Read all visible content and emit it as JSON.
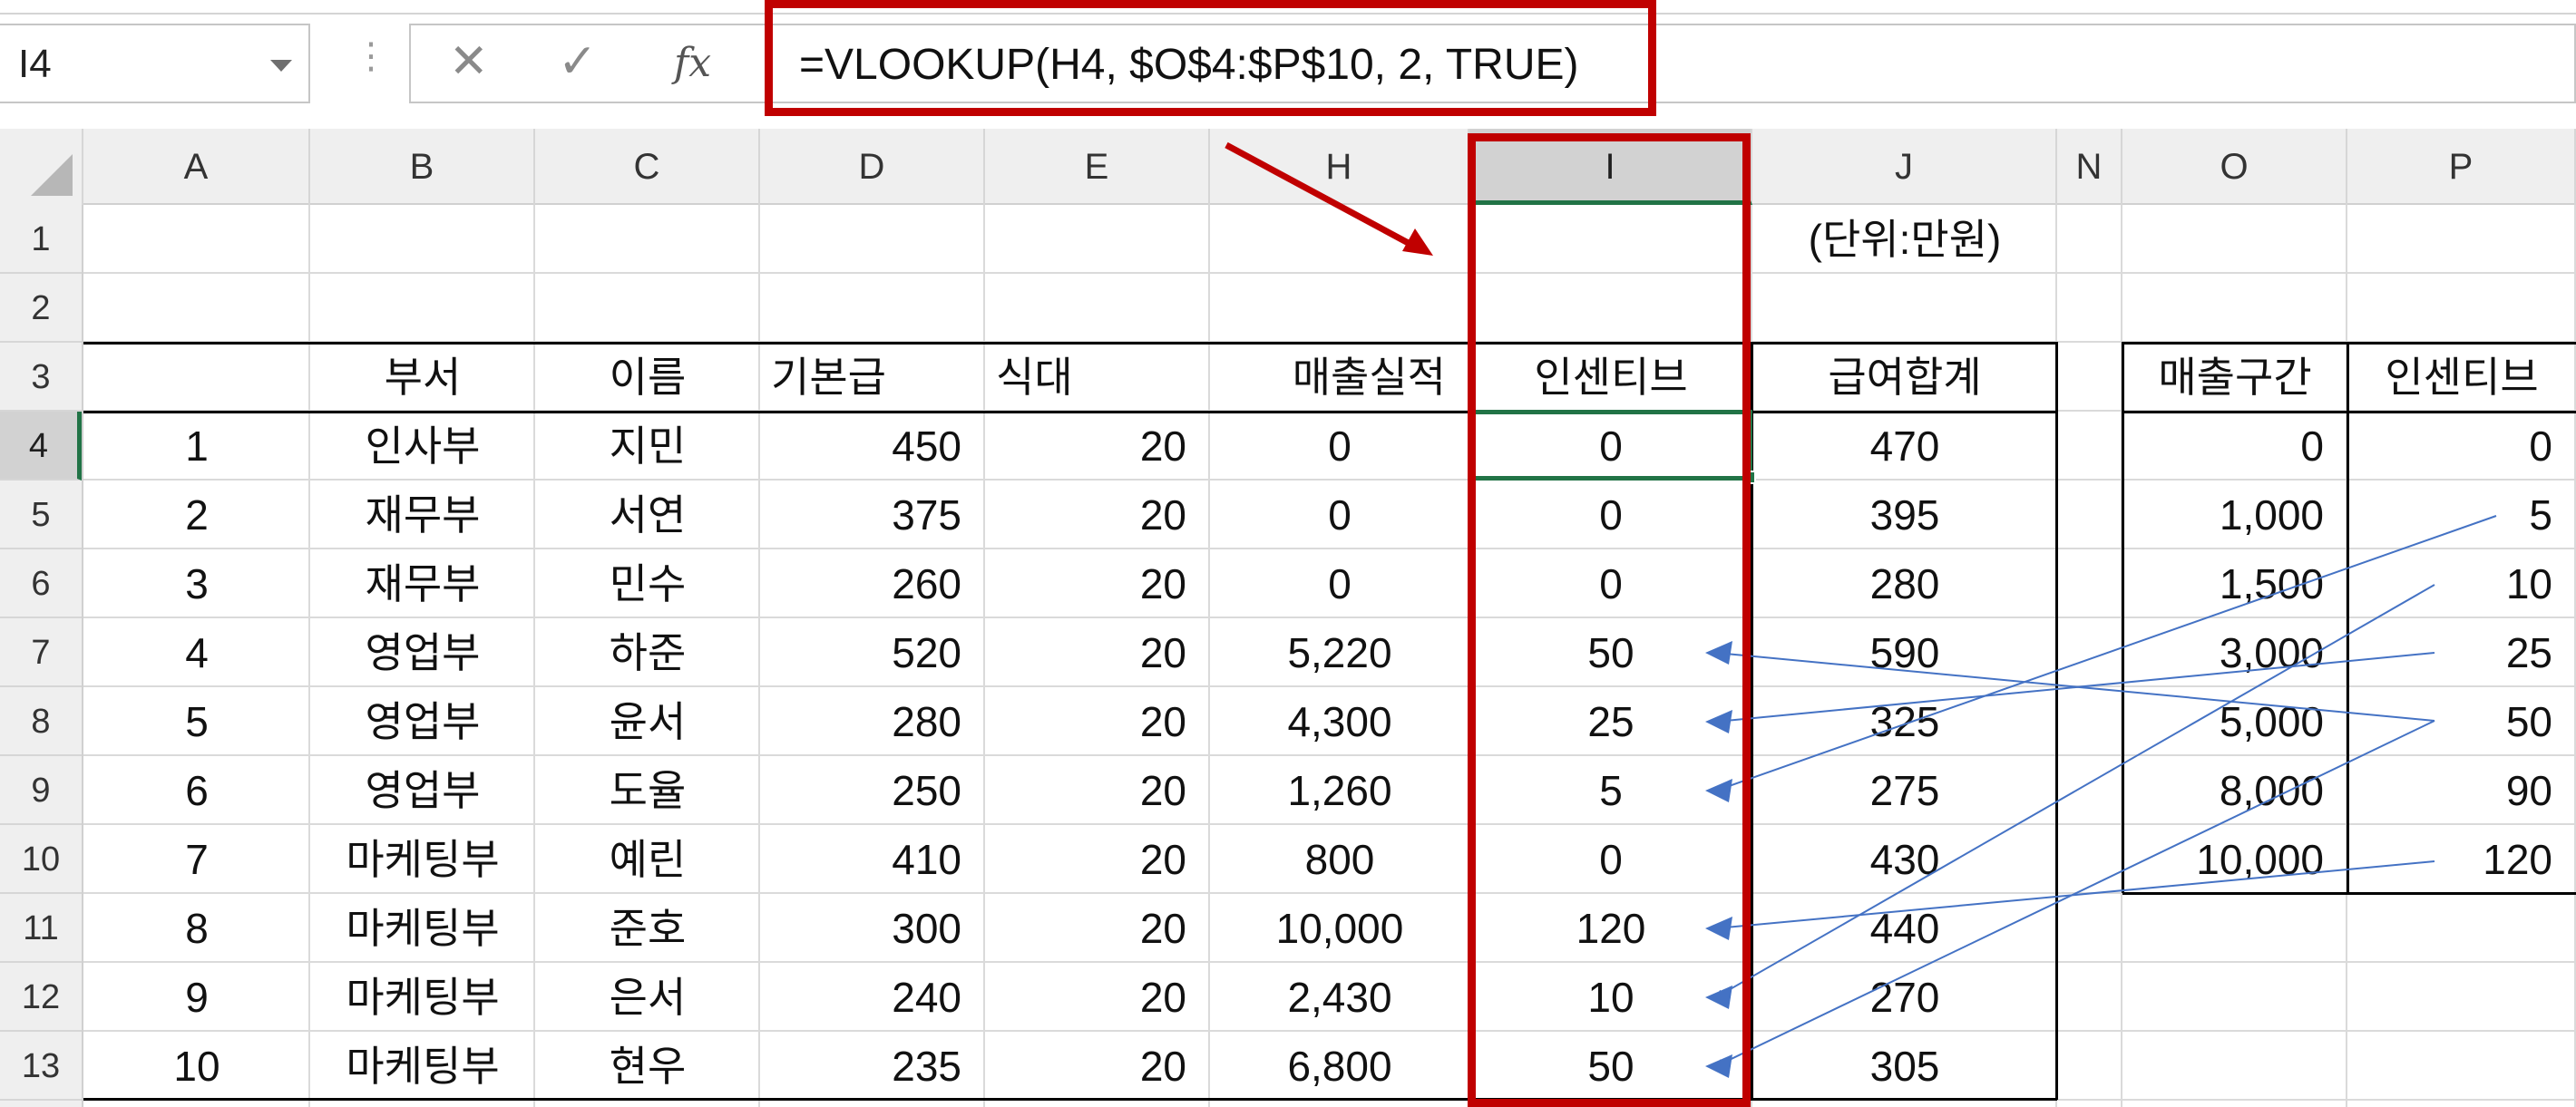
{
  "formula_bar": {
    "name_box": "I4",
    "cancel_icon": "cancel-x-icon",
    "enter_icon": "enter-check-icon",
    "function_icon": "insert-function-fx-icon",
    "function_label": "fx",
    "formula": "=VLOOKUP(H4, $O$4:$P$10, 2, TRUE)"
  },
  "grid": {
    "selected_cell": "I4",
    "selected_column": "I",
    "selected_row": "4",
    "columns": [
      "A",
      "B",
      "C",
      "D",
      "E",
      "H",
      "I",
      "J",
      "N",
      "O",
      "P"
    ],
    "rows": [
      "1",
      "2",
      "3",
      "4",
      "5",
      "6",
      "7",
      "8",
      "9",
      "10",
      "11",
      "12",
      "13"
    ],
    "unit_note": "(단위:만원)",
    "main_headers": [
      "부서",
      "이름",
      "기본급",
      "식대",
      "매출실적",
      "인센티브",
      "급여합계"
    ],
    "main_rows": [
      [
        "1",
        "인사부",
        "지민",
        "450",
        "20",
        "0",
        "0",
        "470"
      ],
      [
        "2",
        "재무부",
        "서연",
        "375",
        "20",
        "0",
        "0",
        "395"
      ],
      [
        "3",
        "재무부",
        "민수",
        "260",
        "20",
        "0",
        "0",
        "280"
      ],
      [
        "4",
        "영업부",
        "하준",
        "520",
        "20",
        "5,220",
        "50",
        "590"
      ],
      [
        "5",
        "영업부",
        "윤서",
        "280",
        "20",
        "4,300",
        "25",
        "325"
      ],
      [
        "6",
        "영업부",
        "도율",
        "250",
        "20",
        "1,260",
        "5",
        "275"
      ],
      [
        "7",
        "마케팅부",
        "예린",
        "410",
        "20",
        "800",
        "0",
        "430"
      ],
      [
        "8",
        "마케팅부",
        "준호",
        "300",
        "20",
        "10,000",
        "120",
        "440"
      ],
      [
        "9",
        "마케팅부",
        "은서",
        "240",
        "20",
        "2,430",
        "10",
        "270"
      ],
      [
        "10",
        "마케팅부",
        "현우",
        "235",
        "20",
        "6,800",
        "50",
        "305"
      ]
    ],
    "lookup_headers": [
      "매출구간",
      "인센티브"
    ],
    "lookup_rows": [
      [
        "0",
        "0"
      ],
      [
        "1,000",
        "5"
      ],
      [
        "1,500",
        "10"
      ],
      [
        "3,000",
        "25"
      ],
      [
        "5,000",
        "50"
      ],
      [
        "8,000",
        "90"
      ],
      [
        "10,000",
        "120"
      ]
    ]
  },
  "annotation": {
    "highlight_color": "#c00000",
    "arrow_color": "#4472c4"
  }
}
